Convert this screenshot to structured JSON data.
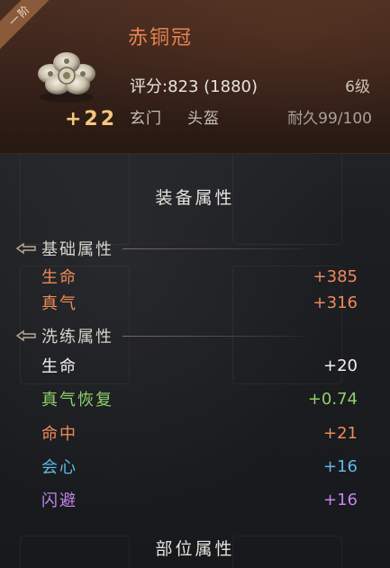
{
  "item": {
    "grade_tag": "一阶",
    "name": "赤铜冠",
    "score": "评分:823 (1880)",
    "level": "6级",
    "enhance": "+22",
    "school": "玄门",
    "slot": "头盔",
    "durability": "耐久99/100",
    "icon": "silver-flower-helmet-icon"
  },
  "sections": {
    "equip_attrs": "装备属性",
    "base_attrs": "基础属性",
    "refine_attrs": "洗练属性",
    "part_attrs": "部位属性"
  },
  "base_rows": [
    {
      "label": "生命",
      "value": "+385",
      "color": "#f08a58"
    },
    {
      "label": "真气",
      "value": "+316",
      "color": "#f08a58"
    }
  ],
  "refine_rows": [
    {
      "label": "生命",
      "value": "+20",
      "color": "#f2f0ec"
    },
    {
      "label": "真气恢复",
      "value": "+0.74",
      "color": "#8fd06a"
    },
    {
      "label": "命中",
      "value": "+21",
      "color": "#f08a58"
    },
    {
      "label": "会心",
      "value": "+16",
      "color": "#5fb8e8"
    },
    {
      "label": "闪避",
      "value": "+16",
      "color": "#c383f0"
    }
  ]
}
